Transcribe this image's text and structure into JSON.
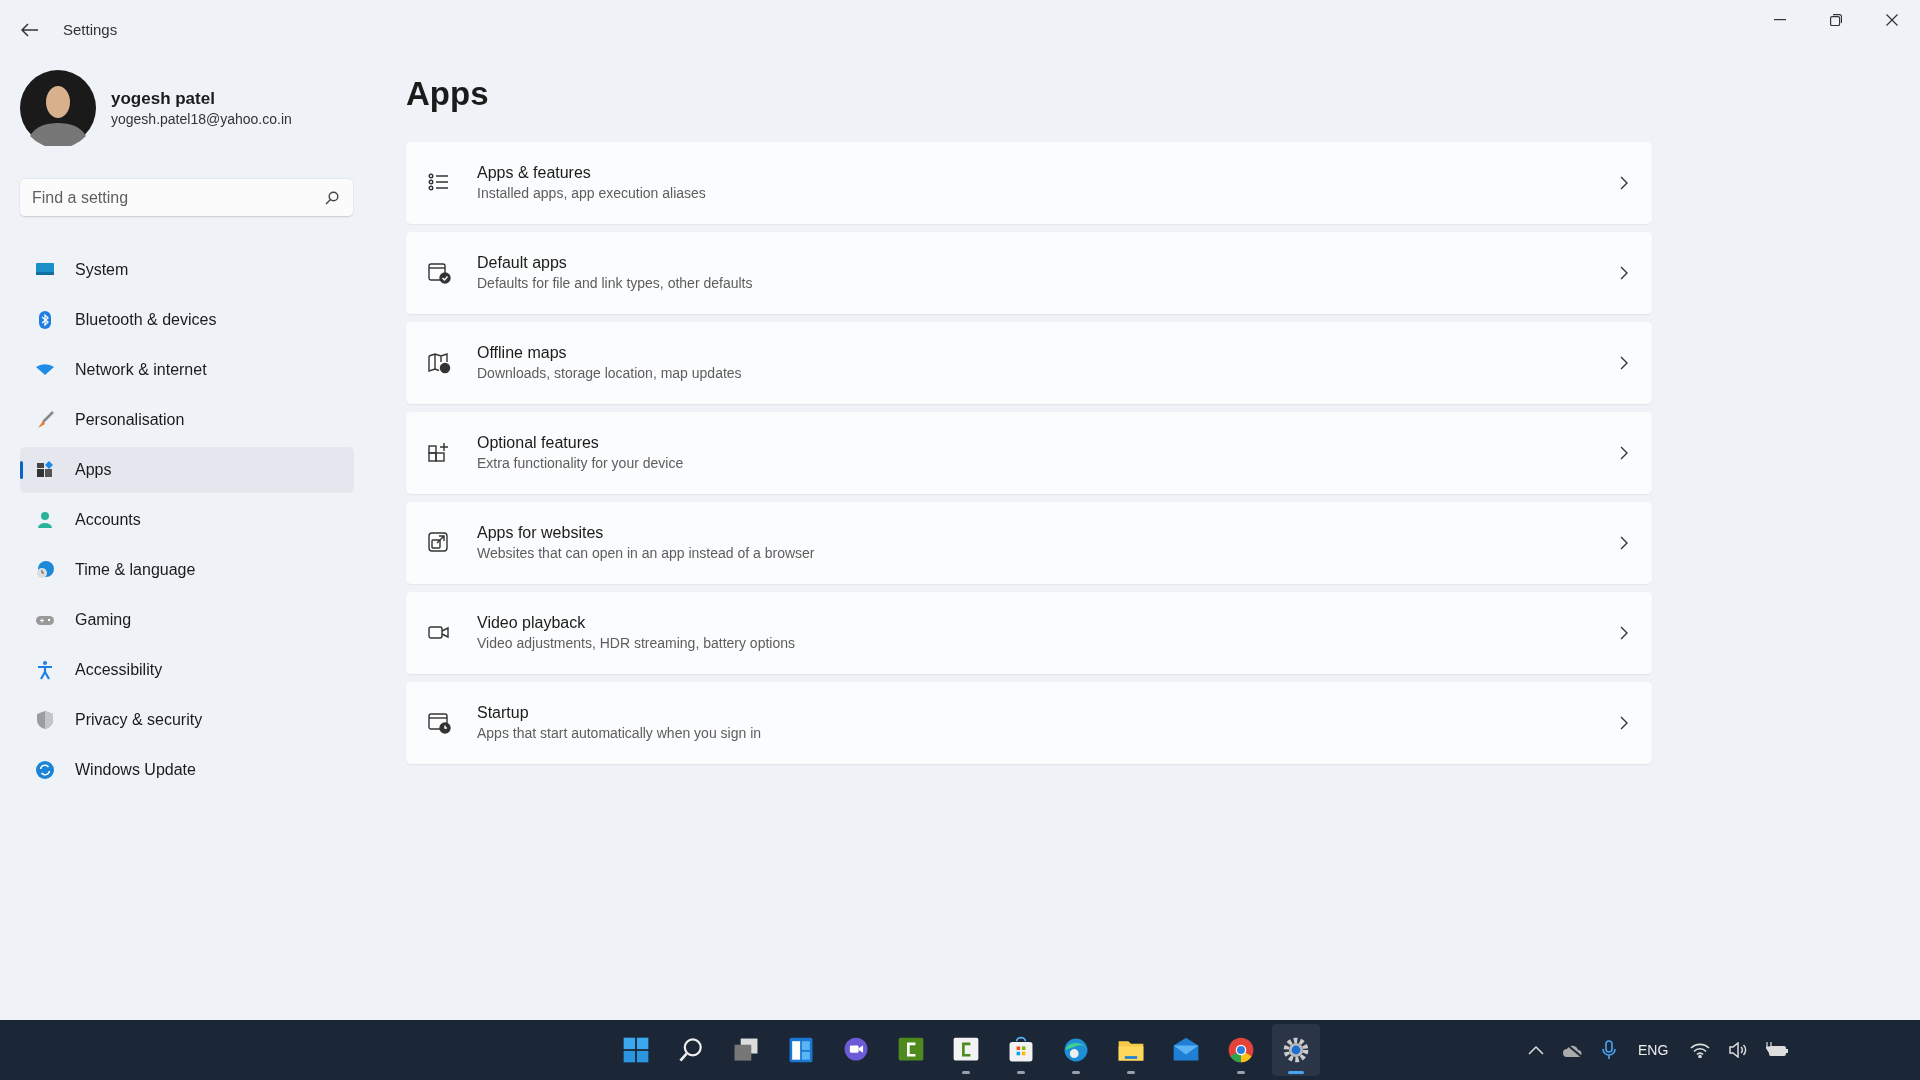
{
  "window": {
    "title": "Settings"
  },
  "user": {
    "name": "yogesh patel",
    "email": "yogesh.patel18@yahoo.co.in"
  },
  "search": {
    "placeholder": "Find a setting"
  },
  "sidebar": {
    "items": [
      {
        "label": "System",
        "selected": false
      },
      {
        "label": "Bluetooth & devices",
        "selected": false
      },
      {
        "label": "Network & internet",
        "selected": false
      },
      {
        "label": "Personalisation",
        "selected": false
      },
      {
        "label": "Apps",
        "selected": true
      },
      {
        "label": "Accounts",
        "selected": false
      },
      {
        "label": "Time & language",
        "selected": false
      },
      {
        "label": "Gaming",
        "selected": false
      },
      {
        "label": "Accessibility",
        "selected": false
      },
      {
        "label": "Privacy & security",
        "selected": false
      },
      {
        "label": "Windows Update",
        "selected": false
      }
    ]
  },
  "page": {
    "title": "Apps",
    "items": [
      {
        "title": "Apps & features",
        "description": "Installed apps, app execution aliases"
      },
      {
        "title": "Default apps",
        "description": "Defaults for file and link types, other defaults"
      },
      {
        "title": "Offline maps",
        "description": "Downloads, storage location, map updates"
      },
      {
        "title": "Optional features",
        "description": "Extra functionality for your device"
      },
      {
        "title": "Apps for websites",
        "description": "Websites that can open in an app instead of a browser"
      },
      {
        "title": "Video playback",
        "description": "Video adjustments, HDR streaming, battery options"
      },
      {
        "title": "Startup",
        "description": "Apps that start automatically when you sign in"
      }
    ]
  },
  "taskbar": {
    "apps": [
      {
        "running": false,
        "selected": false
      },
      {
        "running": false,
        "selected": false
      },
      {
        "running": false,
        "selected": false
      },
      {
        "running": false,
        "selected": false
      },
      {
        "running": false,
        "selected": false
      },
      {
        "running": false,
        "selected": false
      },
      {
        "running": true,
        "selected": false
      },
      {
        "running": true,
        "selected": false
      },
      {
        "running": true,
        "selected": false
      },
      {
        "running": true,
        "selected": false
      },
      {
        "running": false,
        "selected": false
      },
      {
        "running": true,
        "selected": false
      },
      {
        "running": true,
        "selected": true
      }
    ],
    "tray": {
      "language": "ENG"
    }
  }
}
